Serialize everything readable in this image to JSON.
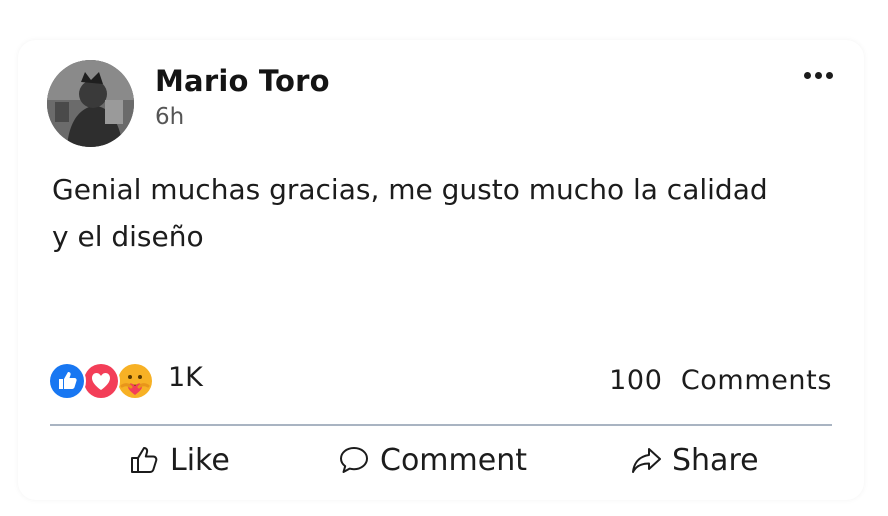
{
  "post": {
    "author": "Mario Toro",
    "time": "6h",
    "text": "Genial muchas gracias, me gusto mucho la calidad y el diseño"
  },
  "stats": {
    "reactions_count": "1K",
    "comments_count": "100  Comments",
    "reaction_types": [
      "like-icon",
      "love-icon",
      "care-icon"
    ]
  },
  "actions": {
    "like": "Like",
    "comment": "Comment",
    "share": "Share"
  },
  "colors": {
    "like_blue": "#1877f2",
    "love_red": "#f33e58",
    "care_yellow": "#f7b125",
    "divider": "#a9b4c2"
  }
}
